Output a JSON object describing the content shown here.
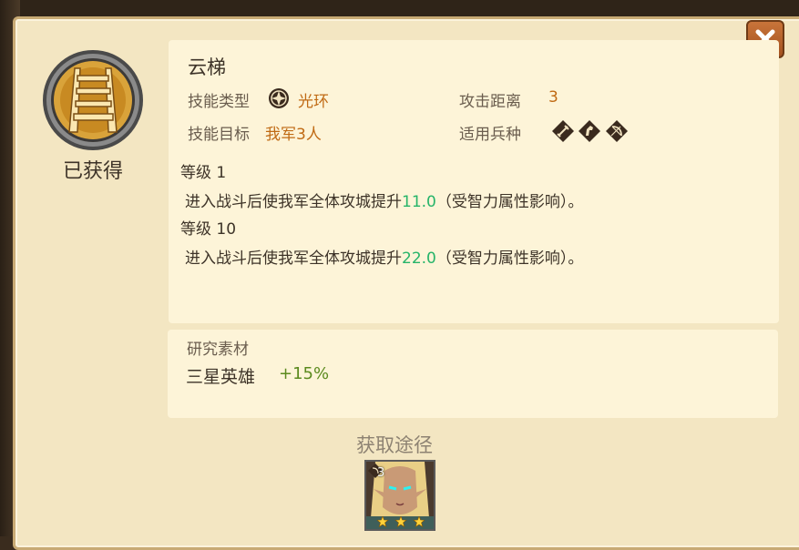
{
  "skill": {
    "name": "云梯",
    "status": "已获得",
    "type_label": "技能类型",
    "type_value": "光环",
    "target_label": "技能目标",
    "target_value": "我军3人",
    "range_label": "攻击距离",
    "range_value": "3",
    "units_label": "适用兵种",
    "unit_icons": [
      "sword-icon",
      "horse-icon",
      "bow-icon"
    ]
  },
  "levels": [
    {
      "label": "等级 1",
      "desc_prefix": "进入战斗后使我军全体攻城提升",
      "value": "11.0",
      "desc_suffix": "（受智力属性影响）。"
    },
    {
      "label": "等级 10",
      "desc_prefix": "进入战斗后使我军全体攻城提升",
      "value": "22.0",
      "desc_suffix": "（受智力属性影响）。"
    }
  ],
  "research": {
    "title": "研究素材",
    "material": "三星英雄",
    "bonus": "+15%"
  },
  "source": {
    "title": "获取途径",
    "hero_level": "3",
    "hero_stars": 3
  },
  "colors": {
    "accent_orange": "#c06a14",
    "value_green": "#26b469",
    "bonus_green": "#5b8a1e",
    "panel_bg": "#f3e6c2",
    "card_bg": "#fdf4d8"
  }
}
